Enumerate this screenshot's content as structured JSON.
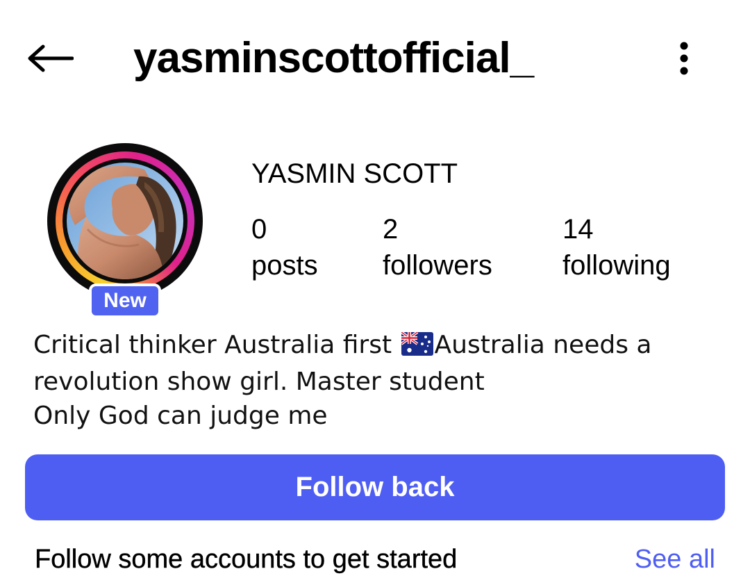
{
  "header": {
    "username": "yasminscottofficial_",
    "back_icon": "arrow-left-icon",
    "more_icon": "more-vertical-icon"
  },
  "profile": {
    "full_name": "YASMIN SCOTT",
    "avatar_badge": "New",
    "story_ring_colors": [
      "#f8d12e",
      "#f5505c",
      "#e0218a",
      "#c72fbd"
    ]
  },
  "stats": [
    {
      "value": "0",
      "label": "posts"
    },
    {
      "value": "2",
      "label": "followers"
    },
    {
      "value": "14",
      "label": "following"
    }
  ],
  "bio": {
    "line1_a": "Critical thinker Australia first ",
    "flag_icon": "australia-flag-icon",
    "line1_b": "Australia needs a",
    "line2": "revolution show girl. Master student",
    "line3": "Only God can judge me"
  },
  "actions": {
    "follow_back_label": "Follow back"
  },
  "suggestions": {
    "text": "Follow some accounts to get started",
    "see_all_label": "See all"
  },
  "colors": {
    "accent": "#4f5ef2",
    "badge": "#5063f0"
  }
}
